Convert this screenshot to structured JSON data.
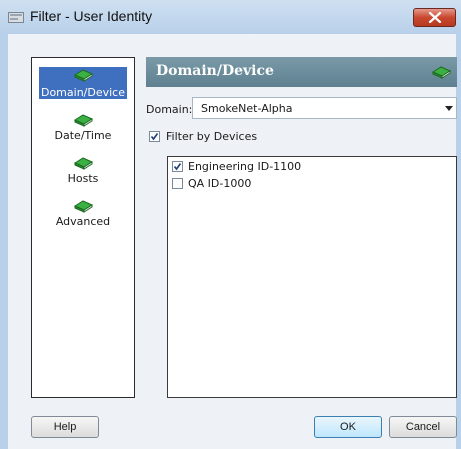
{
  "window": {
    "title": "Filter - User Identity"
  },
  "nav": {
    "items": [
      {
        "label": "Domain/Device",
        "selected": true
      },
      {
        "label": "Date/Time",
        "selected": false
      },
      {
        "label": "Hosts",
        "selected": false
      },
      {
        "label": "Advanced",
        "selected": false
      }
    ]
  },
  "panel": {
    "title": "Domain/Device",
    "domain_label": "Domain:",
    "domain_value": "SmokeNet-Alpha",
    "filter_by_devices_label": "Filter by Devices",
    "filter_by_devices_checked": true,
    "devices": [
      {
        "label": "Engineering ID-1100",
        "checked": true
      },
      {
        "label": "QA ID-1000",
        "checked": false
      }
    ]
  },
  "buttons": {
    "help": "Help",
    "ok": "OK",
    "cancel": "Cancel"
  },
  "colors": {
    "selection": "#3f6fbf",
    "header": "#6a8b99",
    "icon_green": "#2e9a35",
    "close": "#c9472f"
  },
  "icons": {
    "title": "filter-icon",
    "nav": "green-book-icon",
    "close": "close-icon"
  }
}
